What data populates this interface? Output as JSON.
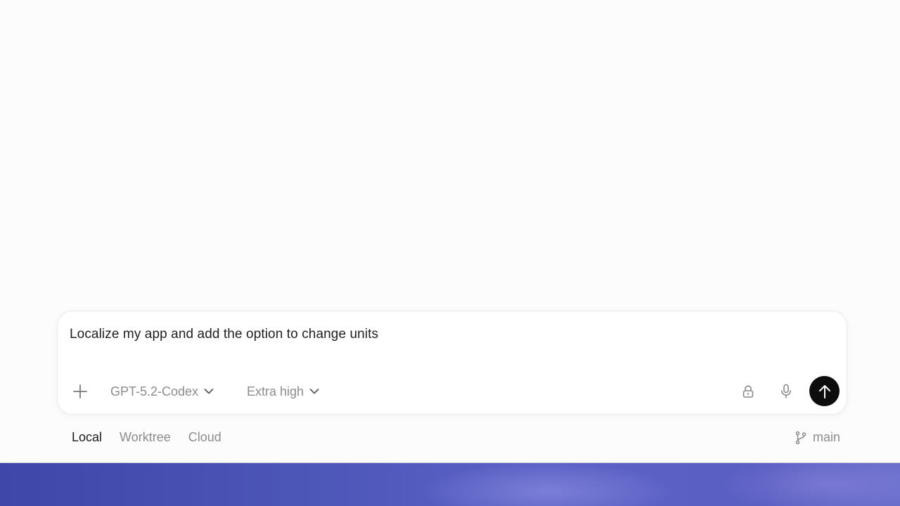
{
  "composer": {
    "prompt_text": "Localize my app and add the option to change units",
    "add_icon": "plus-icon",
    "model_label": "GPT-5.2-Codex",
    "effort_label": "Extra high",
    "lock_icon": "lock-icon",
    "mic_icon": "microphone-icon",
    "send_icon": "arrow-up-icon"
  },
  "modes": {
    "local": "Local",
    "worktree": "Worktree",
    "cloud": "Cloud",
    "active": "Local"
  },
  "branch": {
    "name": "main",
    "icon": "git-branch-icon"
  },
  "colors": {
    "accent": "#0d0d0d",
    "muted_text": "#8c8c8c",
    "text": "#1f1f1f"
  }
}
